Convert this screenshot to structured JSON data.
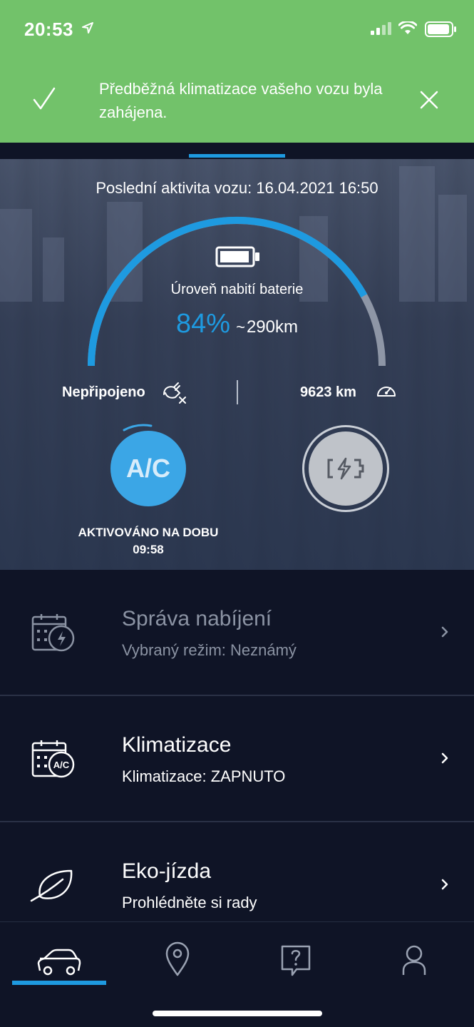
{
  "status_bar": {
    "time": "20:53"
  },
  "banner": {
    "message": "Předběžná klimatizace vašeho vozu byla zahájena.",
    "color": "#72c26a"
  },
  "vehicle": {
    "last_activity": "Poslední aktivita vozu: 16.04.2021 16:50",
    "battery_label": "Úroveň nabití baterie",
    "soc": "84%",
    "soc_value": 0.84,
    "range_tilde": "~",
    "range": "290km",
    "plug_status": "Nepřipojeno",
    "odometer": "9623 km",
    "ac_button_label": "A/C",
    "ac_status_line1": "AKTIVOVÁNO NA DOBU",
    "ac_status_line2": "09:58",
    "accent_color": "#1e9ae0"
  },
  "list": {
    "items": [
      {
        "title": "Správa nabíjení",
        "subtitle": "Vybraný režim: Neznámý",
        "icon": "charging-calendar-icon",
        "enabled": false
      },
      {
        "title": "Klimatizace",
        "subtitle": "Klimatizace: ZAPNUTO",
        "icon": "climate-calendar-icon",
        "enabled": true
      },
      {
        "title": "Eko-jízda",
        "subtitle": "Prohlédněte si rady",
        "icon": "leaf-icon",
        "enabled": true
      }
    ]
  },
  "nav": {
    "items": [
      {
        "icon": "car-icon",
        "active": true
      },
      {
        "icon": "location-pin-icon",
        "active": false
      },
      {
        "icon": "help-icon",
        "active": false
      },
      {
        "icon": "profile-icon",
        "active": false
      }
    ]
  }
}
